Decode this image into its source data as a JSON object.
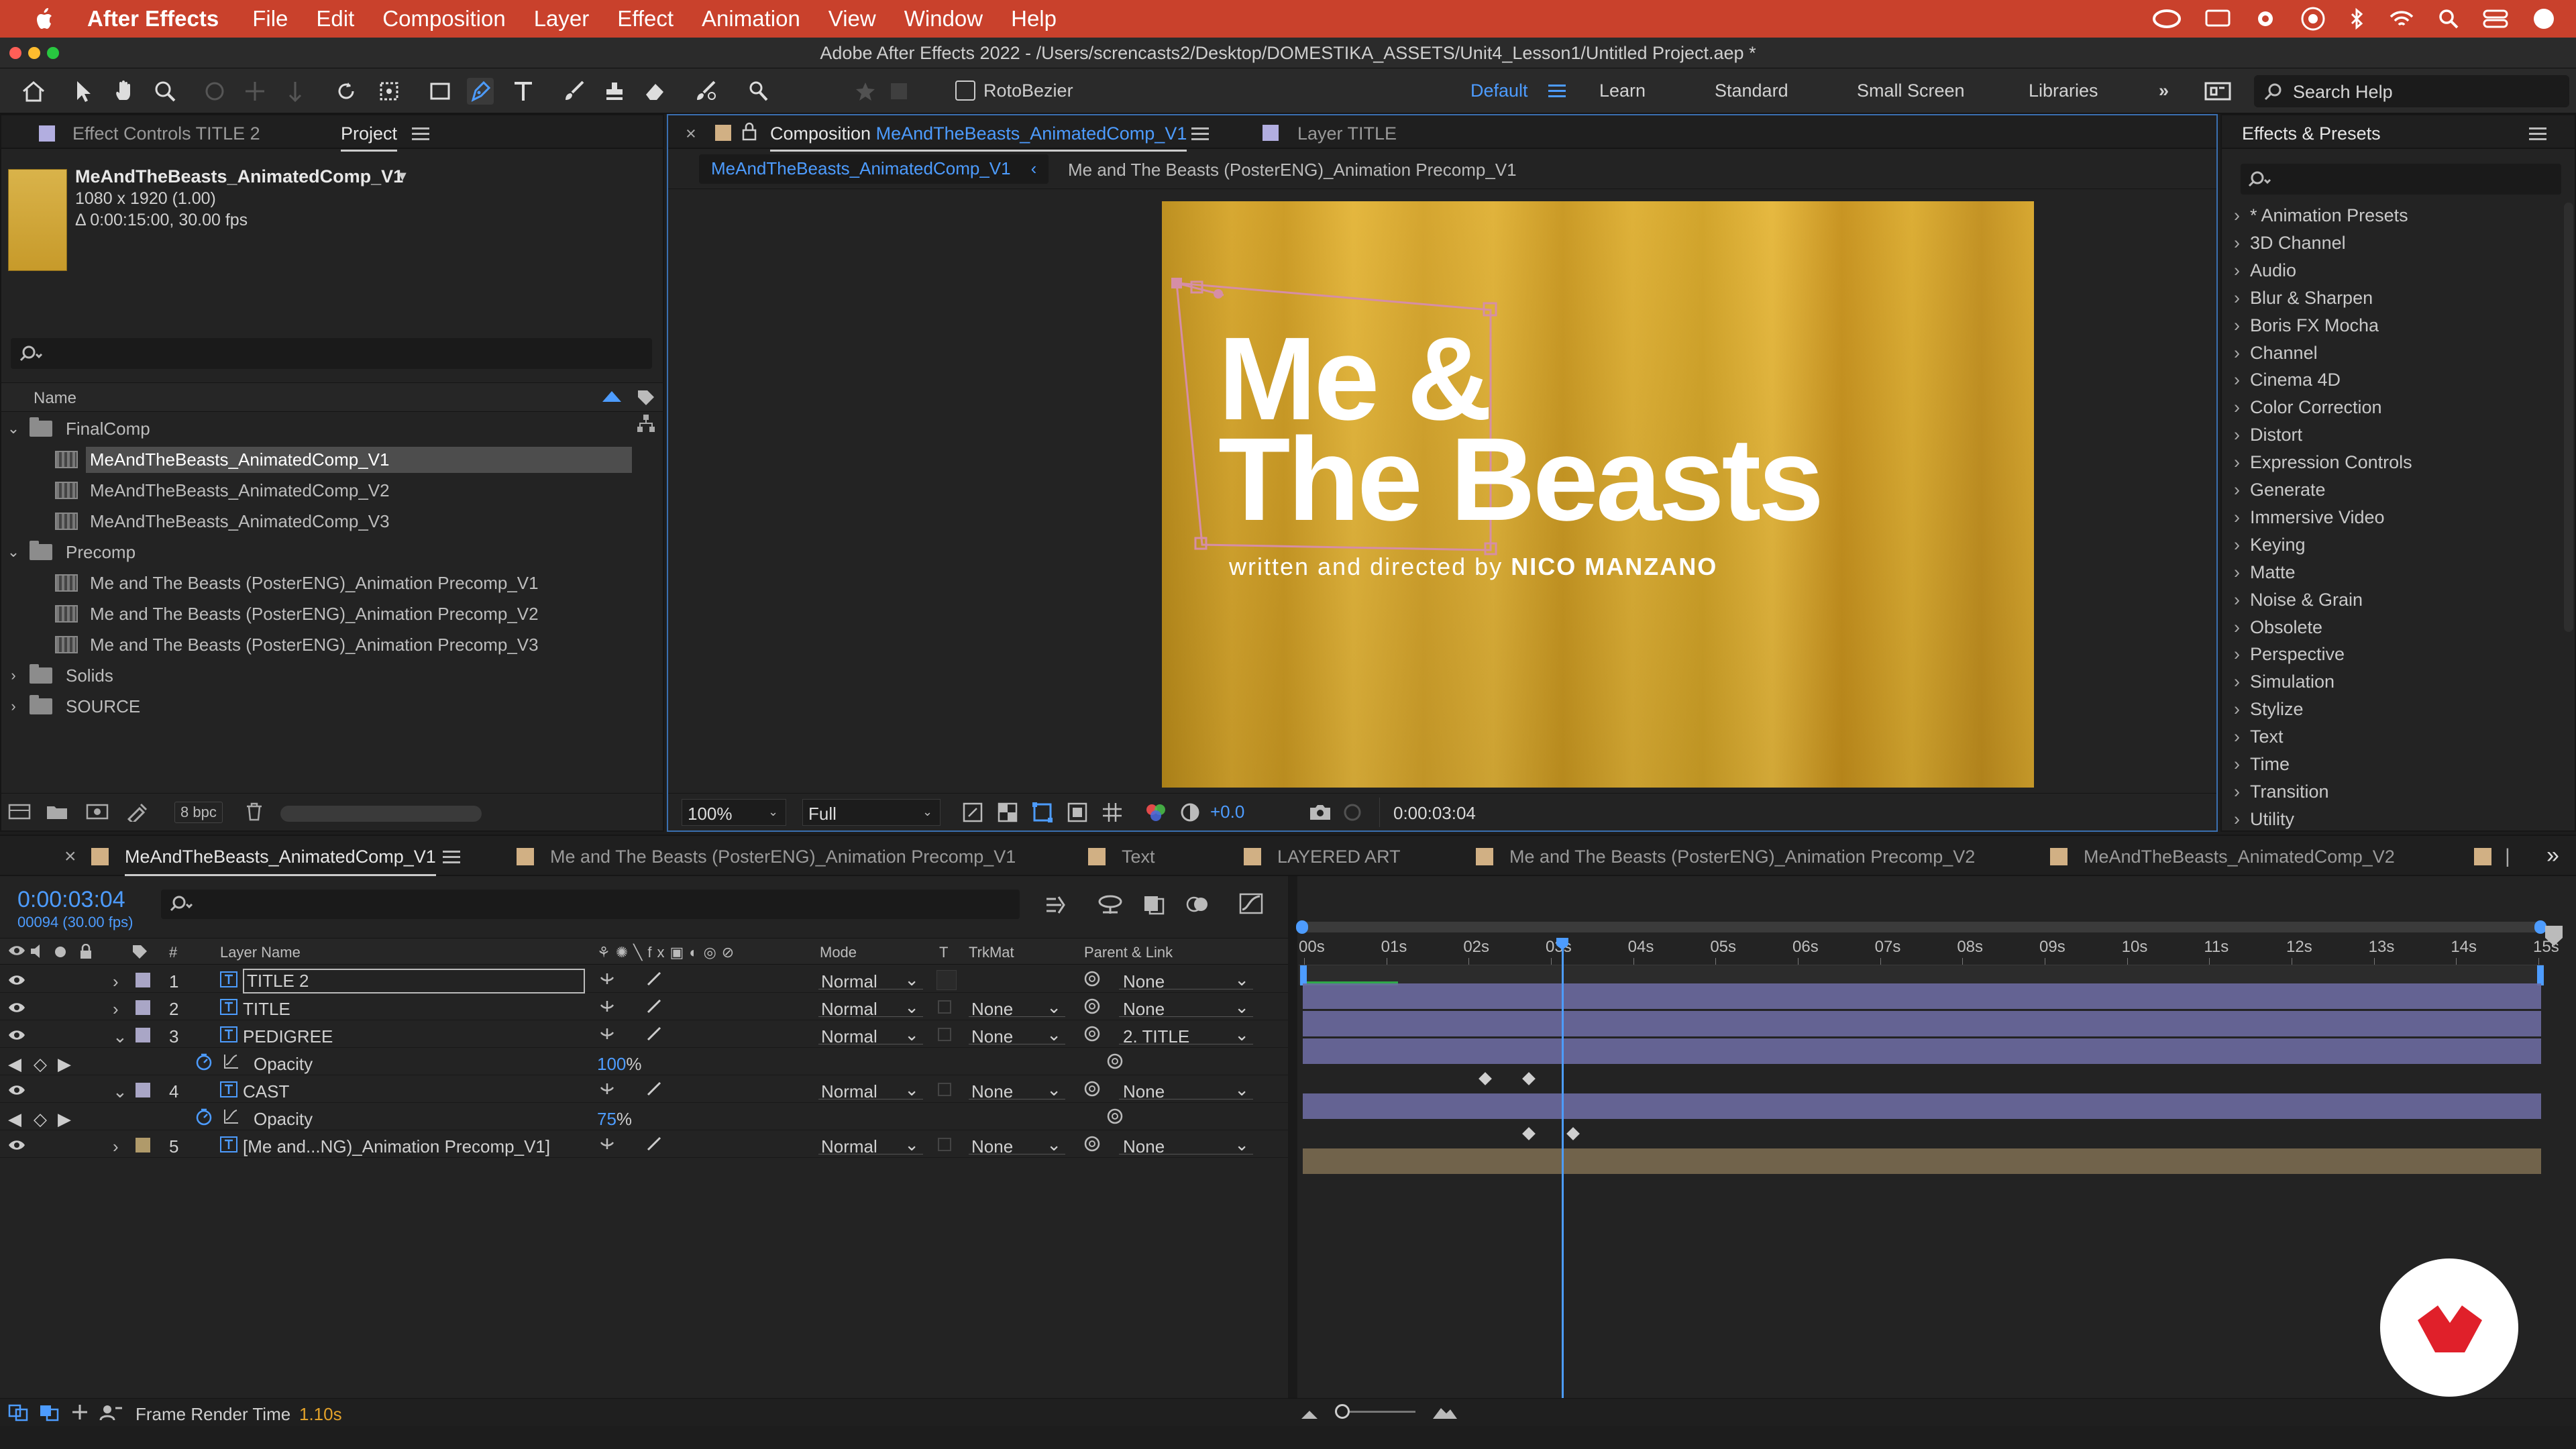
{
  "menubar": {
    "app_name": "After Effects",
    "items": [
      "File",
      "Edit",
      "Composition",
      "Layer",
      "Effect",
      "Animation",
      "View",
      "Window",
      "Help"
    ]
  },
  "window": {
    "title": "Adobe After Effects 2022 - /Users/screncasts2/Desktop/DOMESTIKA_ASSETS/Unit4_Lesson1/Untitled Project.aep *"
  },
  "toolbar": {
    "rotobezier_label": "RotoBezier",
    "workspaces": [
      "Default",
      "Learn",
      "Standard",
      "Small Screen",
      "Libraries"
    ],
    "active_workspace": "Default",
    "search_help": "Search Help"
  },
  "project_panel": {
    "tab_effect_controls": "Effect Controls TITLE 2",
    "tab_project": "Project",
    "comp_name": "MeAndTheBeasts_AnimatedComp_V1",
    "comp_size": "1080 x 1920 (1.00)",
    "comp_duration": "Δ 0:00:15:00, 30.00 fps",
    "name_header": "Name",
    "bpc": "8 bpc",
    "items": [
      {
        "type": "folder",
        "open": true,
        "label": "FinalComp",
        "indent": 0
      },
      {
        "type": "comp",
        "label": "MeAndTheBeasts_AnimatedComp_V1",
        "indent": 1,
        "selected": true
      },
      {
        "type": "comp",
        "label": "MeAndTheBeasts_AnimatedComp_V2",
        "indent": 1
      },
      {
        "type": "comp",
        "label": "MeAndTheBeasts_AnimatedComp_V3",
        "indent": 1
      },
      {
        "type": "folder",
        "open": true,
        "label": "Precomp",
        "indent": 0
      },
      {
        "type": "comp",
        "label": "Me and The Beasts (PosterENG)_Animation Precomp_V1",
        "indent": 1
      },
      {
        "type": "comp",
        "label": "Me and The Beasts (PosterENG)_Animation Precomp_V2",
        "indent": 1
      },
      {
        "type": "comp",
        "label": "Me and The Beasts (PosterENG)_Animation Precomp_V3",
        "indent": 1
      },
      {
        "type": "folder",
        "open": false,
        "label": "Solids",
        "indent": 0
      },
      {
        "type": "folder",
        "open": false,
        "label": "SOURCE",
        "indent": 0
      }
    ]
  },
  "composition_panel": {
    "tab_label_prefix": "Composition",
    "tab_comp": "MeAndTheBeasts_AnimatedComp_V1",
    "tab_layer": "Layer TITLE",
    "breadcrumb_1": "MeAndTheBeasts_AnimatedComp_V1",
    "breadcrumb_2": "Me and The Beasts (PosterENG)_Animation Precomp_V1",
    "title_line1": "Me &",
    "title_line2": "The Beasts",
    "credit_prefix": "written and directed by",
    "credit_name": "NICO MANZANO",
    "zoom": "100%",
    "resolution": "Full",
    "exposure": "+0.0",
    "timecode": "0:00:03:04"
  },
  "effects_panel": {
    "title": "Effects & Presets",
    "categories": [
      "* Animation Presets",
      "3D Channel",
      "Audio",
      "Blur & Sharpen",
      "Boris FX Mocha",
      "Channel",
      "Cinema 4D",
      "Color Correction",
      "Distort",
      "Expression Controls",
      "Generate",
      "Immersive Video",
      "Keying",
      "Matte",
      "Noise & Grain",
      "Obsolete",
      "Perspective",
      "Simulation",
      "Stylize",
      "Text",
      "Time",
      "Transition",
      "Utility"
    ]
  },
  "timeline": {
    "tabs": [
      "MeAndTheBeasts_AnimatedComp_V1",
      "Me and The Beasts (PosterENG)_Animation Precomp_V1",
      "Text",
      "LAYERED ART",
      "Me and The Beasts (PosterENG)_Animation Precomp_V2",
      "MeAndTheBeasts_AnimatedComp_V2"
    ],
    "timecode": "0:00:03:04",
    "frame_info": "00094 (30.00 fps)",
    "headers": {
      "num": "#",
      "layer_name": "Layer Name",
      "mode": "Mode",
      "t": "T",
      "trkmat": "TrkMat",
      "parent": "Parent & Link"
    },
    "ruler": [
      "00s",
      "01s",
      "02s",
      "03s",
      "04s",
      "05s",
      "06s",
      "07s",
      "08s",
      "09s",
      "10s",
      "11s",
      "12s",
      "13s",
      "14s",
      "15s"
    ],
    "current_time_seconds": 3.13,
    "work_area_end_seconds": 15,
    "layers": [
      {
        "num": "1",
        "name": "TITLE 2",
        "color": "#a9a6c6",
        "type": "text",
        "mode": "Normal",
        "trkmat": "",
        "parent": "None",
        "selected": true,
        "bar": "#6c6aa0"
      },
      {
        "num": "2",
        "name": "TITLE",
        "color": "#a9a6c6",
        "type": "text",
        "mode": "Normal",
        "trkmat": "None",
        "parent": "None",
        "bar": "#6c6aa0"
      },
      {
        "num": "3",
        "name": "PEDIGREE",
        "color": "#a9a6c6",
        "type": "text",
        "mode": "Normal",
        "trkmat": "None",
        "parent": "2. TITLE",
        "open": true,
        "bar": "#6c6aa0"
      },
      {
        "prop": true,
        "name": "Opacity",
        "value": "100",
        "unit": "%",
        "keyframes_seconds": [
          2.2,
          2.73
        ]
      },
      {
        "num": "4",
        "name": "CAST",
        "color": "#a9a6c6",
        "type": "text",
        "mode": "Normal",
        "trkmat": "None",
        "parent": "None",
        "open": true,
        "bar": "#6c6aa0"
      },
      {
        "prop": true,
        "name": "Opacity",
        "value": "75",
        "unit": "%",
        "keyframes_seconds": [
          2.73,
          3.27
        ]
      },
      {
        "num": "5",
        "name": "[Me and...NG)_Animation Precomp_V1]",
        "color": "#b09a6a",
        "type": "comp",
        "mode": "Normal",
        "trkmat": "None",
        "parent": "None",
        "bar": "#7a6a50"
      }
    ],
    "footer_label": "Frame Render Time",
    "footer_value": "1.10s"
  },
  "colors": {
    "accent_blue": "#4d9cff",
    "menubar_red": "#c9412c",
    "comp_bg": "#d3a42a",
    "domestika_red": "#e0202a"
  }
}
